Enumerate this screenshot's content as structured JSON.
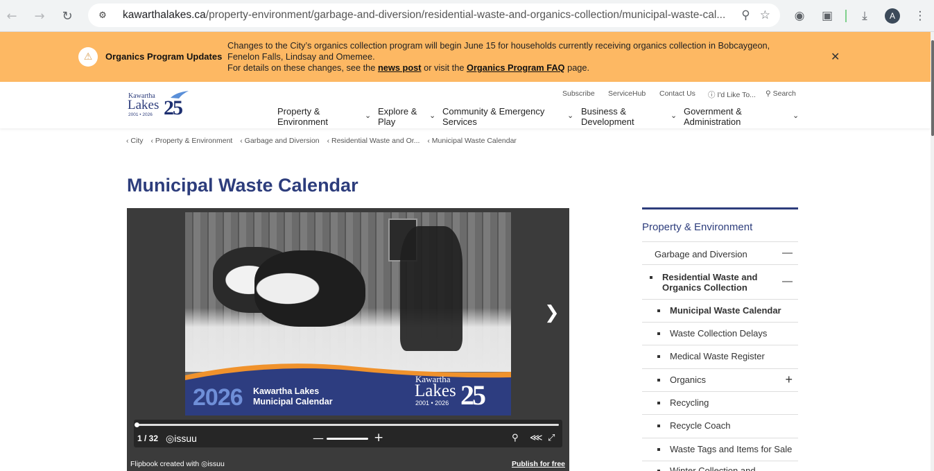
{
  "browser": {
    "url_domain": "kawarthalakes.ca",
    "url_path": "/property-environment/garbage-and-diversion/residential-waste-and-organics-collection/municipal-waste-cal...",
    "avatar_letter": "A"
  },
  "alert": {
    "title": "Organics Program Updates",
    "line1": "Changes to the City’s organics collection program will begin June 15 for households currently receiving organics collection in Bobcaygeon,",
    "line2": "Fenelon Falls, Lindsay and Omemee.",
    "line3_pre": "For details on these changes, see the ",
    "link1": "news post",
    "line3_mid": " or visit the ",
    "link2": "Organics Program FAQ",
    "line3_post": " page."
  },
  "logo": {
    "line1": "Kawartha",
    "line2": "Lakes",
    "years": "2001 • 2026",
    "number": "25"
  },
  "utility_nav": {
    "subscribe": "Subscribe",
    "servicehub": "ServiceHub",
    "contact": "Contact Us",
    "id_like_to": "I'd Like To...",
    "search": "Search"
  },
  "main_nav": [
    {
      "line1": "Property &",
      "line2": "Environment"
    },
    {
      "line1": "Explore &",
      "line2": "Play"
    },
    {
      "line1": "Community & Emergency",
      "line2": "Services"
    },
    {
      "line1": "Business &",
      "line2": "Development"
    },
    {
      "line1": "Government &",
      "line2": "Administration"
    }
  ],
  "breadcrumb": [
    "City",
    "Property & Environment",
    "Garbage and Diversion",
    "Residential Waste and Or...",
    "Municipal Waste Calendar"
  ],
  "page_title": "Municipal Waste Calendar",
  "flipbook": {
    "cover_year": "2026",
    "cover_line1": "Kawartha Lakes",
    "cover_line2": "Municipal Calendar",
    "cover_logo_1": "Kawartha",
    "cover_logo_2": "Lakes",
    "cover_logo_years": "2001 • 2026",
    "cover_logo_num": "25",
    "page_indicator": "1 / 32",
    "brand": "issuu",
    "created_by": "Flipbook created with",
    "publish": "Publish for free",
    "progress_fraction": 0.03125
  },
  "sidenav": {
    "title": "Property & Environment",
    "items": [
      {
        "label": "Garbage and Diversion",
        "toggle": "—"
      },
      {
        "label_l1": "Residential Waste and",
        "label_l2": "Organics Collection",
        "toggle": "—"
      },
      {
        "label": "Municipal Waste Calendar"
      },
      {
        "label": "Waste Collection Delays"
      },
      {
        "label": "Medical Waste Register"
      },
      {
        "label": "Organics",
        "toggle": "+"
      },
      {
        "label": "Recycling"
      },
      {
        "label": "Recycle Coach"
      },
      {
        "label": "Waste Tags and Items for Sale"
      },
      {
        "label": "Winter Collection and"
      }
    ]
  },
  "colors": {
    "brand_navy": "#2d3d7c",
    "alert_bg": "#fdb863",
    "flipbook_bg": "#3b3b3b",
    "cover_blue": "#2d3d80",
    "cover_orange": "#f0922c"
  }
}
